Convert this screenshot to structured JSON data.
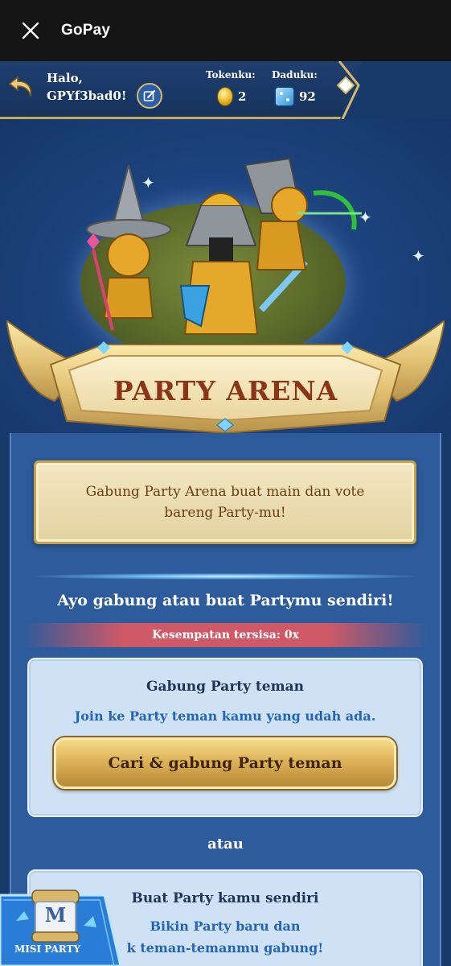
{
  "appbar": {
    "title": "GoPay",
    "close_icon": "close-icon"
  },
  "header": {
    "greeting_line1": "Halo,",
    "username": "GPYf3bad0!",
    "token_label": "Tokenku:",
    "token_value": "2",
    "dice_label": "Daduku:",
    "dice_value": "92"
  },
  "hero": {
    "banner_title": "PARTY ARENA"
  },
  "notice": {
    "text": "Gabung Party Arena buat main dan vote bareng Party-mu!"
  },
  "main": {
    "headline": "Ayo gabung atau buat Partymu sendiri!",
    "chance_text": "Kesempatan tersisa: 0x"
  },
  "join_card": {
    "title": "Gabung Party teman",
    "subtitle": "Join ke Party teman kamu yang udah ada.",
    "button_label": "Cari & gabung Party teman"
  },
  "separator": "atau",
  "create_card": {
    "title": "Buat Party kamu sendiri",
    "subtitle_line1": "Bikin Party baru dan",
    "subtitle_line2": "k teman-temanmu gabung!"
  },
  "misi": {
    "label": "MISI PARTY",
    "badge_letter": "M"
  },
  "colors": {
    "gold": "#d8b76a",
    "banner_text": "#8a3418",
    "chance_red": "#cf5967",
    "link_blue": "#2366b6"
  }
}
